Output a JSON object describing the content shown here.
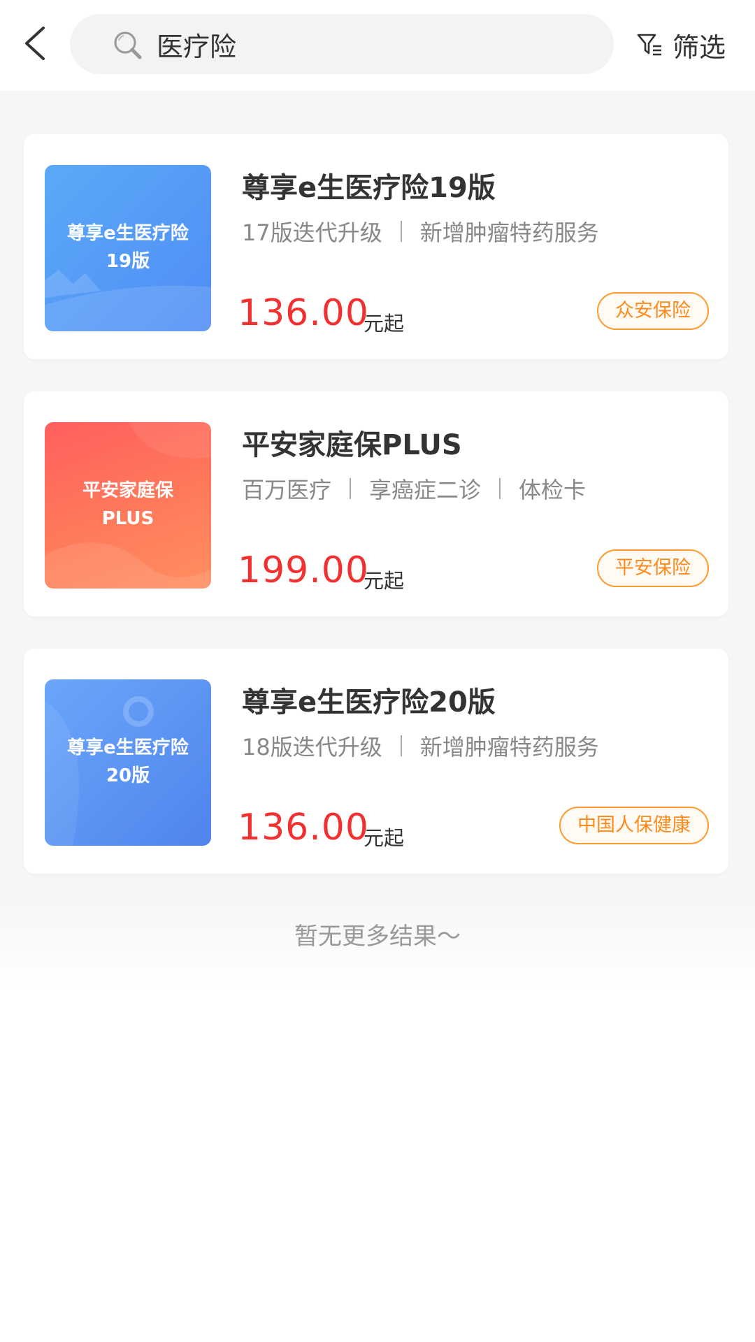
{
  "search": {
    "value": "医疗险"
  },
  "filter": {
    "label": "筛选"
  },
  "results": [
    {
      "thumb_text": "尊享e生医疗险\n19版",
      "title": "尊享e生医疗险19版",
      "tags": [
        "17版迭代升级",
        "新增肿瘤特药服务"
      ],
      "price": "136.00",
      "price_unit": "元起",
      "insurer": "众安保险"
    },
    {
      "thumb_text": "平安家庭保\nPLUS",
      "title": "平安家庭保PLUS",
      "tags": [
        "百万医疗",
        "享癌症二诊",
        "体检卡"
      ],
      "price": "199.00",
      "price_unit": "元起",
      "insurer": "平安保险"
    },
    {
      "thumb_text": "尊享e生医疗险\n20版",
      "title": "尊享e生医疗险20版",
      "tags": [
        "18版迭代升级",
        "新增肿瘤特药服务"
      ],
      "price": "136.00",
      "price_unit": "元起",
      "insurer": "中国人保健康"
    }
  ],
  "footer": {
    "no_more_text": "暂无更多结果～"
  },
  "colors": {
    "price": "#f23030",
    "badge": "#ff8a1c"
  }
}
